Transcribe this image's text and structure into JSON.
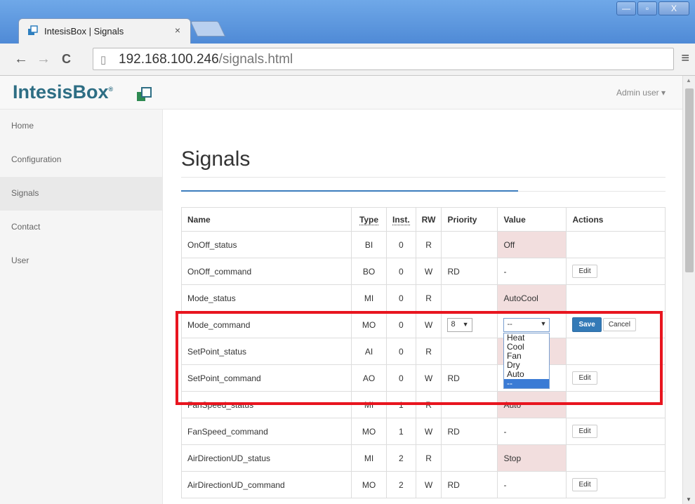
{
  "browser": {
    "tab_title": "IntesisBox | Signals",
    "tab_close": "×",
    "url_host": "192.168.100.246",
    "url_path": "/signals.html",
    "win_minimize": "—",
    "win_maximize": "▫",
    "win_close": "X",
    "back": "←",
    "forward": "→",
    "reload": "C",
    "menu": "≡"
  },
  "header": {
    "brand": "IntesisBox",
    "brand_mark": "®",
    "user_menu": "Admin user ▾"
  },
  "sidebar": {
    "items": [
      {
        "label": "Home"
      },
      {
        "label": "Configuration"
      },
      {
        "label": "Signals"
      },
      {
        "label": "Contact"
      },
      {
        "label": "User"
      }
    ]
  },
  "main": {
    "title": "Signals"
  },
  "table": {
    "headers": {
      "name": "Name",
      "type": "Type",
      "inst": "Inst.",
      "rw": "RW",
      "priority": "Priority",
      "value": "Value",
      "actions": "Actions"
    },
    "rows": [
      {
        "name": "OnOff_status",
        "type": "BI",
        "inst": "0",
        "rw": "R",
        "priority": "",
        "value": "Off"
      },
      {
        "name": "OnOff_command",
        "type": "BO",
        "inst": "0",
        "rw": "W",
        "priority": "RD",
        "value": "-",
        "action": "Edit"
      },
      {
        "name": "Mode_status",
        "type": "MI",
        "inst": "0",
        "rw": "R",
        "priority": "",
        "value": "AutoCool"
      },
      {
        "name": "Mode_command",
        "type": "MO",
        "inst": "0",
        "rw": "W",
        "priority_select": "8",
        "value_select": "--",
        "save": "Save",
        "cancel": "Cancel"
      },
      {
        "name": "SetPoint_status",
        "type": "AI",
        "inst": "0",
        "rw": "R",
        "priority": "",
        "value": ""
      },
      {
        "name": "SetPoint_command",
        "type": "AO",
        "inst": "0",
        "rw": "W",
        "priority": "RD",
        "value": "",
        "action": "Edit"
      },
      {
        "name": "FanSpeed_status",
        "type": "MI",
        "inst": "1",
        "rw": "R",
        "priority": "",
        "value": "Auto"
      },
      {
        "name": "FanSpeed_command",
        "type": "MO",
        "inst": "1",
        "rw": "W",
        "priority": "RD",
        "value": "-",
        "action": "Edit"
      },
      {
        "name": "AirDirectionUD_status",
        "type": "MI",
        "inst": "2",
        "rw": "R",
        "priority": "",
        "value": "Stop"
      },
      {
        "name": "AirDirectionUD_command",
        "type": "MO",
        "inst": "2",
        "rw": "W",
        "priority": "RD",
        "value": "-",
        "action": "Edit"
      }
    ]
  },
  "value_dropdown": {
    "options": [
      "Heat",
      "Cool",
      "Fan",
      "Dry",
      "Auto",
      "--"
    ],
    "selected": "--"
  },
  "colors": {
    "brand": "#2e6e84",
    "highlight": "#e8151f",
    "value_cell": "#f2dede",
    "primary": "#337ab7"
  }
}
